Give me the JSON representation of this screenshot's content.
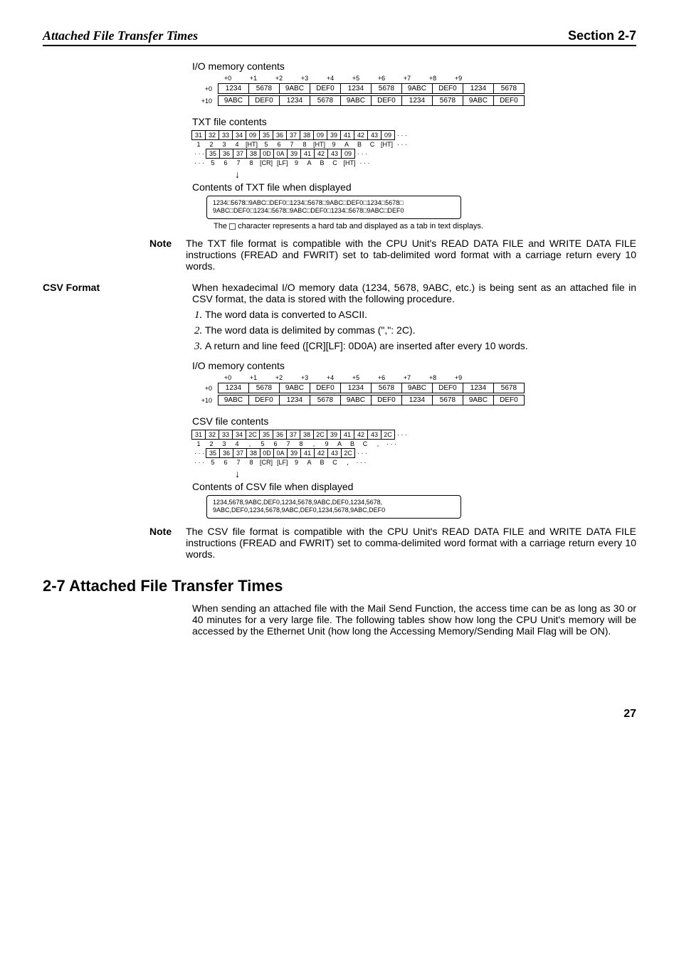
{
  "header": {
    "left": "Attached File Transfer Times",
    "right": "Section 2-7"
  },
  "iomem": {
    "title": "I/O memory contents",
    "cols": [
      "+0",
      "+1",
      "+2",
      "+3",
      "+4",
      "+5",
      "+6",
      "+7",
      "+8",
      "+9"
    ],
    "rowlabels": [
      "+0",
      "+10"
    ],
    "row0": [
      "1234",
      "5678",
      "9ABC",
      "DEF0",
      "1234",
      "5678",
      "9ABC",
      "DEF0",
      "1234",
      "5678"
    ],
    "row1": [
      "9ABC",
      "DEF0",
      "1234",
      "5678",
      "9ABC",
      "DEF0",
      "1234",
      "5678",
      "9ABC",
      "DEF0"
    ]
  },
  "txt": {
    "title": "TXT file contents",
    "r1hex": [
      "31",
      "32",
      "33",
      "34",
      "09",
      "35",
      "36",
      "37",
      "38",
      "09",
      "39",
      "41",
      "42",
      "43",
      "09"
    ],
    "r1asc": [
      "1",
      "2",
      "3",
      "4",
      "[HT]",
      "5",
      "6",
      "7",
      "8",
      "[HT]",
      "9",
      "A",
      "B",
      "C",
      "[HT]"
    ],
    "r2hex": [
      "35",
      "36",
      "37",
      "38",
      "0D",
      "0A",
      "39",
      "41",
      "42",
      "43",
      "09"
    ],
    "r2asc": [
      "5",
      "6",
      "7",
      "8",
      "[CR]",
      "[LF]",
      "9",
      "A",
      "B",
      "C",
      "[HT]"
    ],
    "disp_title": "Contents of TXT file when displayed",
    "disp_line1": "1234□5678□9ABC□DEF0□1234□5678□9ABC□DEF0□1234□5678□",
    "disp_line2": "9ABC□DEF0□1234□5678□9ABC□DEF0□1234□5678□9ABC□DEF0",
    "caption_pre": "The ",
    "caption_post": " character represents a hard tab and displayed as a tab in text displays."
  },
  "note1": {
    "label": "Note",
    "body": "The TXT file format is compatible with the CPU Unit's READ DATA FILE and WRITE DATA FILE instructions (FREAD and FWRIT) set to tab-delimited word format with a carriage return every 10 words."
  },
  "csv": {
    "label": "CSV Format",
    "intro": "When hexadecimal I/O memory data (1234, 5678, 9ABC, etc.) is being sent as an attached file in CSV format, the data is stored with the following procedure.",
    "list": [
      "The word data is converted to ASCII.",
      "The word data is delimited by commas (\",\": 2C).",
      "A return and line feed ([CR][LF]: 0D0A) are inserted after every 10 words."
    ],
    "filetitle": "CSV file contents",
    "r1hex": [
      "31",
      "32",
      "33",
      "34",
      "2C",
      "35",
      "36",
      "37",
      "38",
      "2C",
      "39",
      "41",
      "42",
      "43",
      "2C"
    ],
    "r1asc": [
      "1",
      "2",
      "3",
      "4",
      ",",
      "5",
      "6",
      "7",
      "8",
      ",",
      "9",
      "A",
      "B",
      "C",
      ","
    ],
    "r2hex": [
      "35",
      "36",
      "37",
      "38",
      "0D",
      "0A",
      "39",
      "41",
      "42",
      "43",
      "2C"
    ],
    "r2asc": [
      "5",
      "6",
      "7",
      "8",
      "[CR]",
      "[LF]",
      "9",
      "A",
      "B",
      "C",
      ","
    ],
    "disp_title": "Contents of CSV file when displayed",
    "disp_line1": "1234,5678,9ABC,DEF0,1234,5678,9ABC,DEF0,1234,5678,",
    "disp_line2": "9ABC,DEF0,1234,5678,9ABC,DEF0,1234,5678,9ABC,DEF0"
  },
  "note2": {
    "label": "Note",
    "body": "The CSV file format is compatible with the CPU Unit's READ DATA FILE and WRITE DATA FILE instructions (FREAD and FWRIT) set to comma-delimited word format with a carriage return every 10 words."
  },
  "sec27": {
    "heading": "2-7    Attached File Transfer Times",
    "body": "When sending an attached file with the Mail Send Function, the access time can be as long as 30 or 40 minutes for a very large file. The following tables show how long the CPU Unit's memory will be accessed by the Ethernet Unit (how long the Accessing Memory/Sending Mail Flag will be ON)."
  },
  "pagenum": "27"
}
